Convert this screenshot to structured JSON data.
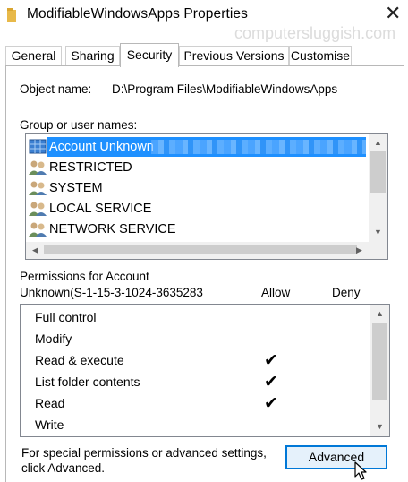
{
  "window": {
    "title": "ModifiableWindowsApps Properties",
    "close_glyph": "✕",
    "folder_icon": "folder-icon"
  },
  "watermark": "computersluggish.com",
  "tabs": [
    {
      "label": "General",
      "active": false
    },
    {
      "label": "Sharing",
      "active": false
    },
    {
      "label": "Security",
      "active": true
    },
    {
      "label": "Previous Versions",
      "active": false
    },
    {
      "label": "Customise",
      "active": false
    }
  ],
  "security": {
    "object_name_label": "Object name:",
    "object_name_value": "D:\\Program Files\\ModifiableWindowsApps",
    "group_label": "Group or user names:",
    "users": [
      {
        "name": "Account Unknown",
        "icon": "unknown-account-icon",
        "selected": true,
        "redacted": true
      },
      {
        "name": "RESTRICTED",
        "icon": "users-group-icon",
        "selected": false
      },
      {
        "name": "SYSTEM",
        "icon": "users-group-icon",
        "selected": false
      },
      {
        "name": "LOCAL SERVICE",
        "icon": "users-group-icon",
        "selected": false
      },
      {
        "name": "NETWORK SERVICE",
        "icon": "users-group-icon",
        "selected": false
      }
    ],
    "permissions_label_line1": "Permissions for Account",
    "permissions_label_line2": "Unknown(S-1-15-3-1024-3635283",
    "allow_header": "Allow",
    "deny_header": "Deny",
    "permissions": [
      {
        "name": "Full control",
        "allow": "",
        "deny": ""
      },
      {
        "name": "Modify",
        "allow": "",
        "deny": ""
      },
      {
        "name": "Read & execute",
        "allow": "✔",
        "deny": ""
      },
      {
        "name": "List folder contents",
        "allow": "✔",
        "deny": ""
      },
      {
        "name": "Read",
        "allow": "✔",
        "deny": ""
      },
      {
        "name": "Write",
        "allow": "",
        "deny": ""
      }
    ],
    "special_text": "For special permissions or advanced settings, click Advanced.",
    "advanced_label": "Advanced"
  },
  "colors": {
    "selection": "#1e90ff",
    "button_focus_border": "#0078d7",
    "button_focus_bg": "#e5f1fb"
  }
}
